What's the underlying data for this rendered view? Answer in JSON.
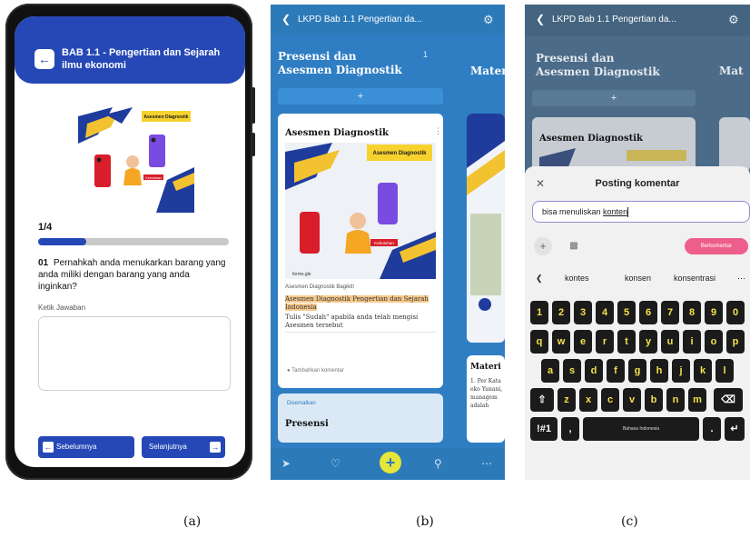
{
  "panel_a": {
    "title": "BAB 1.1 - Pengertian dan Sejarah ilmu ekonomi",
    "artwork_badge": "Asesmen Diagnostik",
    "artwork_label": "Kebutuhan",
    "progress_label": "1/4",
    "progress_fraction": 0.25,
    "question_number": "01",
    "question_text": "Pernahkah anda menukarkan barang yang anda miliki dengan barang yang anda inginkan?",
    "answer_label": "Ketik Jawaban",
    "prev_label": "Sebelumnya",
    "next_label": "Selanjutnya",
    "colors": {
      "primary": "#2548b6"
    }
  },
  "panel_b": {
    "top_title": "LKPD Bab 1.1 Pengertian da...",
    "column1_title": "Presensi dan Asesmen Diagnostik",
    "column2_title": "Mater",
    "column1_count": "1",
    "card_title": "Asesmen Diagnostik",
    "card_badge": "Asesmen Diagnostik",
    "card_art_label": "Kebutuhan",
    "card_art_tag": "forms.gle",
    "card_meta": "Asesmen Diagnostik Bagikit!",
    "card_highlight": "Asesmen Diagnostik Pengertian dan Sejarah Indonesia",
    "card_body": "Tulis \"Sudah\" apabila anda telah mengisi Asesmen tersebut",
    "add_comment": "Tambahkan komentar",
    "pinned_label": "Disematkan",
    "card2_title": "Presensi",
    "side_card_title": "Materi",
    "side_card_text": "1. Per Kata eko Yunani, managem adalah",
    "colors": {
      "background": "#2f7ec3",
      "fab": "#e6e63a"
    }
  },
  "panel_c": {
    "top_title": "LKPD Bab 1.1 Pengertian da...",
    "column1_title": "Presensi dan Asesmen Diagnostik",
    "column2_title": "Mat",
    "card_title": "Asesmen Diagnostik",
    "sheet_title": "Posting komentar",
    "input_text": "bisa menuliskan ",
    "input_underlined": "konten",
    "submit_label": "Berkomentar",
    "suggestions": [
      "kontes",
      "konsen",
      "konsentrasi"
    ],
    "keyboard_numbers": [
      "1",
      "2",
      "3",
      "4",
      "5",
      "6",
      "7",
      "8",
      "9",
      "0"
    ],
    "keyboard_row1": [
      "q",
      "w",
      "e",
      "r",
      "t",
      "y",
      "u",
      "i",
      "o",
      "p"
    ],
    "keyboard_row2": [
      "a",
      "s",
      "d",
      "f",
      "g",
      "h",
      "j",
      "k",
      "l"
    ],
    "keyboard_row3": [
      "z",
      "x",
      "c",
      "v",
      "b",
      "n",
      "m"
    ],
    "space_label": "Bahasa Indonesia",
    "symbols_key": "!#1",
    "comma_key": ",",
    "period_key": ".",
    "colors": {
      "submit": "#ee5e8c",
      "key_text": "#f2e14b"
    }
  },
  "captions": {
    "a": "(a)",
    "b": "(b)",
    "c": "(c)"
  }
}
